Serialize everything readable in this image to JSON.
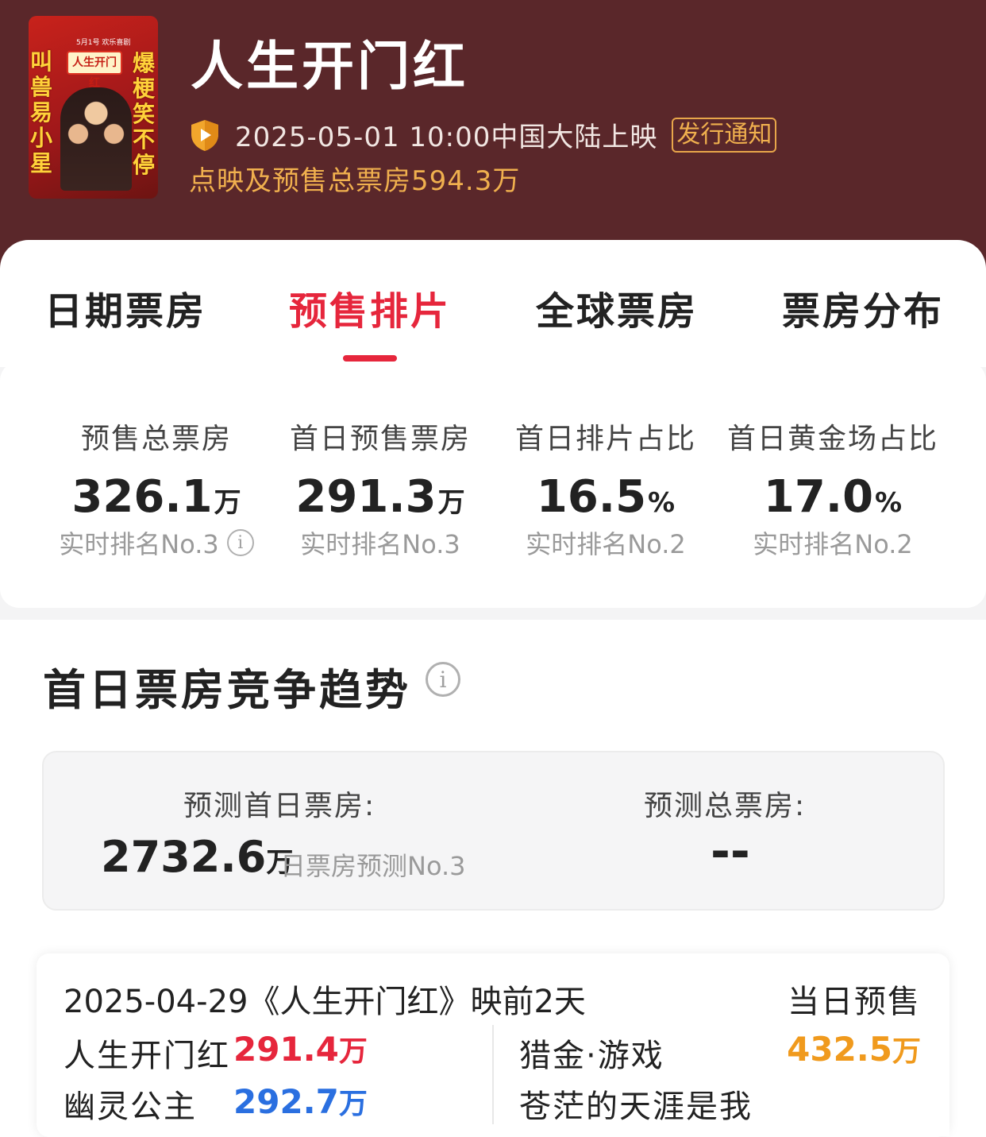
{
  "header": {
    "title": "人生开门红",
    "release": "2025-05-01 10:00中国大陆上映",
    "notice_tag": "发行通知",
    "presale_total": "点映及预售总票房594.3万",
    "poster": {
      "small_text": "5月1号 欢乐喜剧",
      "title": "人生开门红",
      "left_text": "叫兽易小星",
      "right_text": "爆梗笑不停"
    }
  },
  "tabs": [
    {
      "label": "日期票房",
      "active": false
    },
    {
      "label": "预售排片",
      "active": true
    },
    {
      "label": "全球票房",
      "active": false
    },
    {
      "label": "票房分布",
      "active": false
    }
  ],
  "stats": [
    {
      "label": "预售总票房",
      "value": "326.1",
      "unit": "万",
      "rank": "实时排名No.3"
    },
    {
      "label": "首日预售票房",
      "value": "291.3",
      "unit": "万",
      "rank": "实时排名No.3"
    },
    {
      "label": "首日排片占比",
      "value": "16.5",
      "unit": "%",
      "rank": "实时排名No.2"
    },
    {
      "label": "首日黄金场占比",
      "value": "17.0",
      "unit": "%",
      "rank": "实时排名No.2"
    }
  ],
  "trend": {
    "title": "首日票房竞争趋势",
    "forecast_first_day_label": "预测首日票房:",
    "forecast_first_day_value": "2732.6",
    "forecast_first_day_unit": "万",
    "forecast_first_day_rank": "日票房预测No.3",
    "forecast_total_label": "预测总票房:",
    "forecast_total_value": "--"
  },
  "compare": {
    "date_line": "2025-04-29《人生开门红》映前2天",
    "type": "当日预售",
    "rows": [
      {
        "name": "人生开门红",
        "value": "291.4",
        "unit": "万",
        "color": "#e6263c"
      },
      {
        "name": "幽灵公主",
        "value": "292.7",
        "unit": "万",
        "color": "#2a6fe0"
      },
      {
        "name": "猎金·游戏",
        "value": "432.5",
        "unit": "万",
        "color": "#f09a1d"
      },
      {
        "name": "苍茫的天涯是我",
        "value": "",
        "unit": "",
        "color": "#222222"
      }
    ]
  },
  "icons": {
    "shield": "shield-play-icon",
    "info": "info-icon"
  },
  "colors": {
    "header_bg": "#5a272a",
    "accent_red": "#e6263c",
    "gold": "#f0b04e"
  }
}
